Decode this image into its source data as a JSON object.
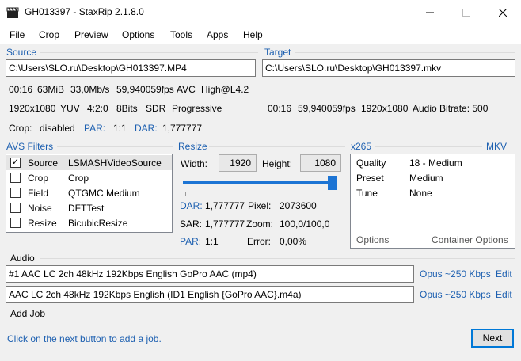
{
  "window": {
    "title": "GH013397 - StaxRip 2.1.8.0"
  },
  "menu": [
    "File",
    "Crop",
    "Preview",
    "Options",
    "Tools",
    "Apps",
    "Help"
  ],
  "source": {
    "label": "Source",
    "path": "C:\\Users\\SLO.ru\\Desktop\\GH013397.MP4",
    "info1": [
      "00:16",
      "63MiB",
      "33,0Mb/s",
      "59,940059fps",
      "AVC",
      "High@L4.2"
    ],
    "info2": [
      "1920x1080",
      "YUV",
      "4:2:0",
      "8Bits",
      "SDR",
      "Progressive"
    ],
    "crop_label": "Crop:",
    "crop_value": "disabled",
    "par_label": "PAR:",
    "par_value": "1:1",
    "dar_label": "DAR:",
    "dar_value": "1,777777"
  },
  "target": {
    "label": "Target",
    "path": "C:\\Users\\SLO.ru\\Desktop\\GH013397.mkv",
    "info": [
      "00:16",
      "59,940059fps",
      "1920x1080",
      "Audio Bitrate: 500"
    ]
  },
  "filters": {
    "label": "AVS Filters",
    "items": [
      {
        "checked": true,
        "name": "Source",
        "value": "LSMASHVideoSource"
      },
      {
        "checked": false,
        "name": "Crop",
        "value": "Crop"
      },
      {
        "checked": false,
        "name": "Field",
        "value": "QTGMC Medium"
      },
      {
        "checked": false,
        "name": "Noise",
        "value": "DFTTest"
      },
      {
        "checked": false,
        "name": "Resize",
        "value": "BicubicResize"
      }
    ]
  },
  "resize": {
    "label": "Resize",
    "width_label": "Width:",
    "width_value": "1920",
    "height_label": "Height:",
    "height_value": "1080",
    "slider_fraction": 1.0,
    "dar_label": "DAR:",
    "dar_value": "1,777777",
    "pixel_label": "Pixel:",
    "pixel_value": "2073600",
    "sar_label": "SAR:",
    "sar_value": "1,777777",
    "zoom_label": "Zoom:",
    "zoom_value": "100,0/100,0",
    "par_label": "PAR:",
    "par_value": "1:1",
    "error_label": "Error:",
    "error_value": "0,00%"
  },
  "encoder": {
    "label": "x265",
    "container": "MKV",
    "rows": [
      {
        "k": "Quality",
        "v": "18 - Medium"
      },
      {
        "k": "Preset",
        "v": "Medium"
      },
      {
        "k": "Tune",
        "v": "None"
      }
    ],
    "options_label": "Options",
    "container_options_label": "Container Options"
  },
  "audio": {
    "label": "Audio",
    "tracks": [
      {
        "text": "#1 AAC LC 2ch 48kHz 192Kbps English GoPro AAC (mp4)",
        "codec": "Opus ~250 Kbps",
        "edit": "Edit"
      },
      {
        "text": "AAC LC 2ch 48kHz 192Kbps English (ID1 English {GoPro AAC}.m4a)",
        "codec": "Opus ~250 Kbps",
        "edit": "Edit"
      }
    ]
  },
  "job": {
    "label": "Add Job",
    "hint": "Click on the next button to add a job.",
    "next_label": "Next"
  },
  "colors": {
    "accent": "#1c5fb0",
    "slider": "#1c74d4"
  }
}
